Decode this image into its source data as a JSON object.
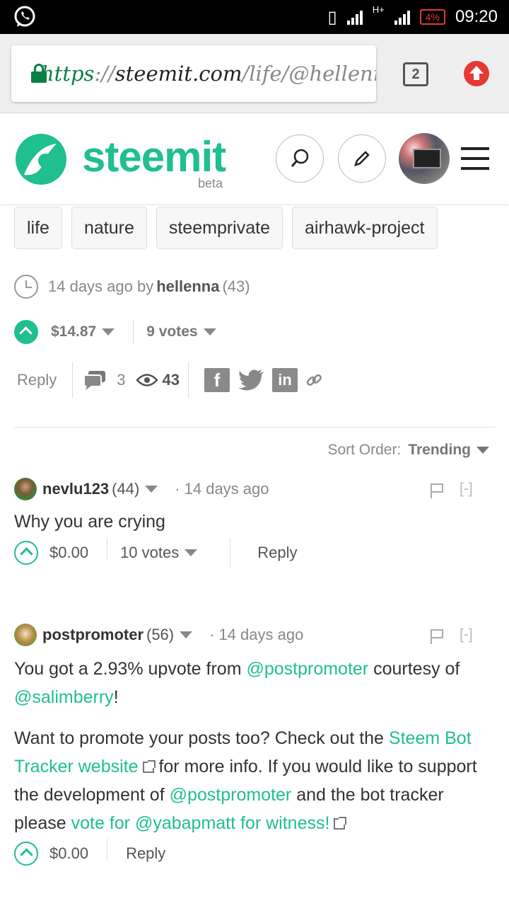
{
  "status_bar": {
    "time": "09:20",
    "battery": "4%",
    "network": "H+"
  },
  "browser": {
    "url_scheme": "https",
    "url_sep": "://",
    "url_host": "steemit.com",
    "url_path": "/life/@hellenn",
    "tab_count": "2"
  },
  "header": {
    "logo": "steemit",
    "beta": "beta"
  },
  "tags": [
    "life",
    "nature",
    "steemprivate",
    "airhawk-project"
  ],
  "post": {
    "time_ago": "14 days ago by",
    "author": "hellenna",
    "reputation": "(43)",
    "payout": "$14.87",
    "votes": "9 votes",
    "reply_label": "Reply",
    "comments": "3",
    "views": "43"
  },
  "sort": {
    "label": "Sort Order:",
    "value": "Trending"
  },
  "comments": [
    {
      "author": "nevlu123",
      "rep": "(44)",
      "time": "14 days ago",
      "collapse": "[-]",
      "body": "Why you are crying",
      "payout": "$0.00",
      "votes": "10 votes",
      "reply": "Reply"
    },
    {
      "author": "postpromoter",
      "rep": "(56)",
      "time": "14 days ago",
      "collapse": "[-]",
      "p1_a": "You got a 2.93% upvote from ",
      "p1_link1": "@postpromoter",
      "p1_b": " courtesy of ",
      "p1_link2": "@salimberry",
      "p1_c": "!",
      "p2_a": "Want to promote your posts too? Check out the ",
      "p2_link1": "Steem Bot Tracker website",
      "p2_b": " for more info. If you would like to support the development of ",
      "p2_link2": "@postpromoter",
      "p2_c": " and the bot tracker please ",
      "p2_link3": "vote for @yabapmatt for witness!",
      "payout": "$0.00",
      "reply": "Reply"
    }
  ],
  "colors": {
    "brand": "#1fbf8f",
    "lock": "#0a8043",
    "upload": "#e53935"
  }
}
